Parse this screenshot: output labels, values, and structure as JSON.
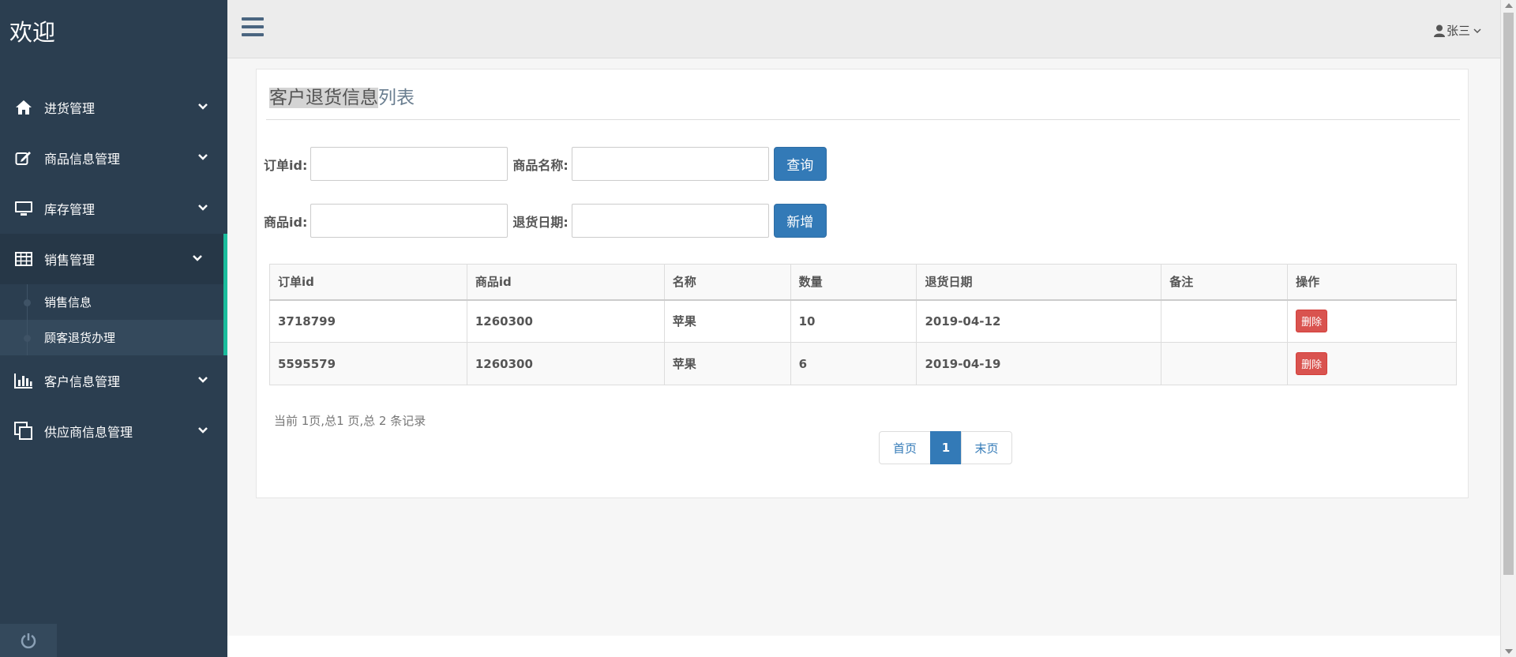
{
  "sidebar": {
    "brand": "欢迎",
    "items": [
      {
        "label": "进货管理",
        "icon": "home-icon"
      },
      {
        "label": "商品信息管理",
        "icon": "edit-icon"
      },
      {
        "label": "库存管理",
        "icon": "monitor-icon"
      },
      {
        "label": "销售管理",
        "icon": "table-icon"
      },
      {
        "label": "客户信息管理",
        "icon": "bar-chart-icon"
      },
      {
        "label": "供应商信息管理",
        "icon": "copy-icon"
      }
    ],
    "sub_items": [
      {
        "label": "销售信息"
      },
      {
        "label": "顾客退货办理"
      }
    ]
  },
  "topbar": {
    "user_name": "张三"
  },
  "panel": {
    "title_highlight": "客户退货信息",
    "title_rest": "列表"
  },
  "form": {
    "order_id_label": "订单id:",
    "order_id_value": "",
    "product_name_label": "商品名称:",
    "product_name_value": "",
    "query_button": "查询",
    "product_id_label": "商品id:",
    "product_id_value": "",
    "return_date_label": "退货日期:",
    "return_date_value": "",
    "add_button": "新增"
  },
  "table": {
    "headers": [
      "订单id",
      "商品id",
      "名称",
      "数量",
      "退货日期",
      "备注",
      "操作"
    ],
    "rows": [
      {
        "order_id": "3718799",
        "product_id": "1260300",
        "name": "苹果",
        "qty": "10",
        "date": "2019-04-12",
        "note": "",
        "action": "删除"
      },
      {
        "order_id": "5595579",
        "product_id": "1260300",
        "name": "苹果",
        "qty": "6",
        "date": "2019-04-19",
        "note": "",
        "action": "删除"
      }
    ]
  },
  "pagination": {
    "info": "当前 1页,总1 页,总 2 条记录",
    "first": "首页",
    "current": "1",
    "last": "末页"
  },
  "colors": {
    "sidebar_bg": "#2b3e50",
    "accent": "#1abc9c",
    "primary": "#337ab7",
    "danger": "#d9534f"
  }
}
